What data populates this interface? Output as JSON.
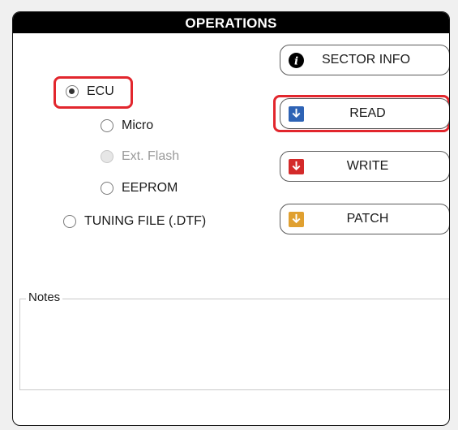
{
  "panel": {
    "title": "OPERATIONS"
  },
  "target": {
    "selected": "ECU",
    "options": [
      {
        "label": "ECU",
        "checked": true,
        "disabled": false
      },
      {
        "label": "Micro",
        "checked": false,
        "disabled": false
      },
      {
        "label": "Ext. Flash",
        "checked": false,
        "disabled": true
      },
      {
        "label": "EEPROM",
        "checked": false,
        "disabled": false
      },
      {
        "label": "TUNING FILE (.DTF)",
        "checked": false,
        "disabled": false
      }
    ]
  },
  "buttons": {
    "sector_info": {
      "label": "SECTOR INFO",
      "icon": "info-icon"
    },
    "read": {
      "label": "READ",
      "icon": "download-arrow-icon",
      "color": "#2e63b5"
    },
    "write": {
      "label": "WRITE",
      "icon": "download-arrow-icon",
      "color": "#d42a2a"
    },
    "patch": {
      "label": "PATCH",
      "icon": "download-arrow-icon",
      "color": "#e0a030"
    }
  },
  "notes": {
    "label": "Notes",
    "value": ""
  },
  "highlight_color": "#e2262d"
}
